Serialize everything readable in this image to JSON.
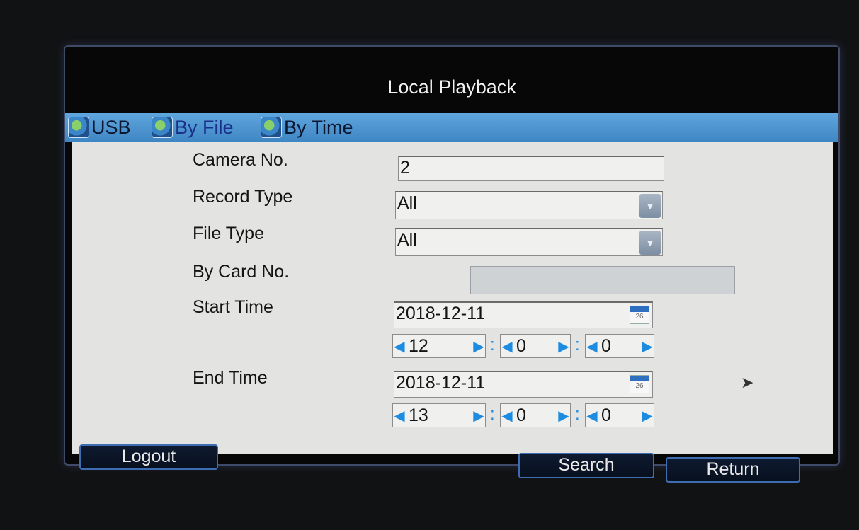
{
  "window": {
    "title": "Local Playback"
  },
  "tabs": [
    {
      "label": "USB",
      "icon": "usb-tab-icon"
    },
    {
      "label": "By File",
      "icon": "by-file-tab-icon",
      "active": true
    },
    {
      "label": "By Time",
      "icon": "by-time-tab-icon"
    }
  ],
  "form": {
    "camera_no_label": "Camera No.",
    "camera_no_value": "2",
    "record_type_label": "Record Type",
    "record_type_value": "All",
    "file_type_label": "File Type",
    "file_type_value": "All",
    "card_no_label": "By Card No.",
    "card_no_value": "",
    "start_time_label": "Start Time",
    "start_date": "2018-12-11",
    "start_hour": "12",
    "start_minute": "0",
    "start_second": "0",
    "end_time_label": "End Time",
    "end_date": "2018-12-11",
    "end_hour": "13",
    "end_minute": "0",
    "end_second": "0",
    "calendar_day": "26"
  },
  "buttons": {
    "logout": "Logout",
    "search": "Search",
    "return": "Return"
  },
  "colors": {
    "tab_bar": "#4f96d1",
    "accent_arrow": "#1d8be0",
    "panel_bg": "#e3e3e1"
  }
}
